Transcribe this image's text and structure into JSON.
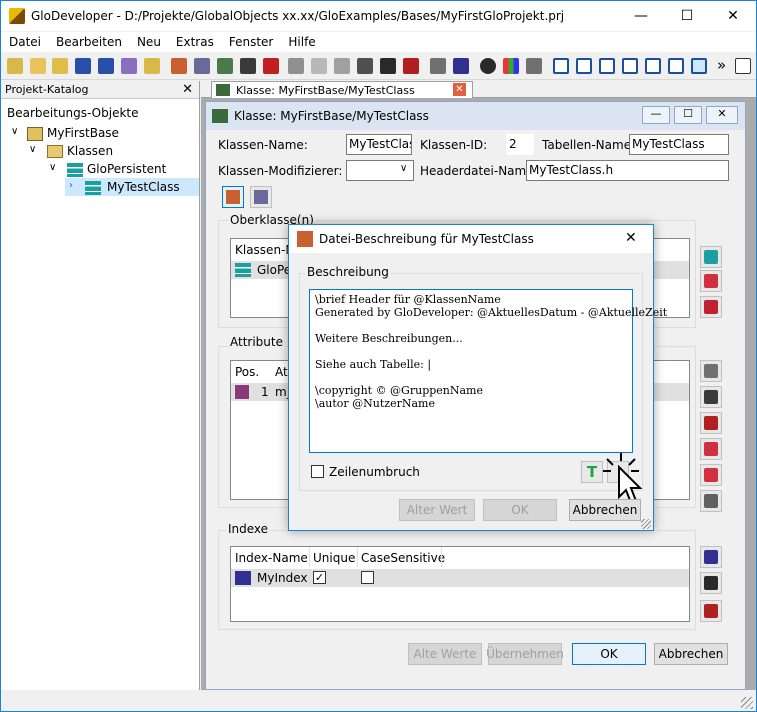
{
  "app": {
    "title": "GloDeveloper - D:/Projekte/GlobalObjects xx.xx/GloExamples/Bases/MyFirstGloProjekt.prj"
  },
  "menu": [
    "Datei",
    "Bearbeiten",
    "Neu",
    "Extras",
    "Fenster",
    "Hilfe"
  ],
  "toolbar": {
    "overflow": "»"
  },
  "catalog": {
    "title": "Projekt-Katalog",
    "root": "Bearbeitungs-Objekte",
    "items": [
      "MyFirstBase",
      "Klassen",
      "GloPersistent",
      "MyTestClass"
    ]
  },
  "tab": {
    "label": "Klasse: MyFirstBase/MyTestClass"
  },
  "classwin": {
    "title": "Klasse: MyFirstBase/MyTestClass",
    "klassen_name_label": "Klassen-Name:",
    "klassen_name": "MyTestClass",
    "klassen_id_label": "Klassen-ID:",
    "klassen_id": "2",
    "tabellen_name_label": "Tabellen-Name :",
    "tabellen_name": "MyTestClass",
    "modifizierer_label": "Klassen-Modifizierer:",
    "modifizierer": "",
    "header_label": "Headerdatei-Name :",
    "header": "MyTestClass.h",
    "oberklasse_label": "Oberklasse(n)",
    "oberklasse_col": "Klassen-N",
    "oberklasse_row": "GloPe",
    "attribute_label": "Attribute",
    "attr_col_pos": "Pos.",
    "attr_col_at": "At",
    "attr_row_pos": "1",
    "attr_row_name": "m_",
    "index_label": "Indexe",
    "index_cols": [
      "Index-Name",
      "Unique",
      "CaseSensitive"
    ],
    "index_row": "MyIndex",
    "btn_alte_werte": "Alte Werte",
    "btn_uebernehmen": "Übernehmen",
    "btn_ok": "OK",
    "btn_abbrechen": "Abbrechen"
  },
  "dialog": {
    "title": "Datei-Beschreibung für MyTestClass",
    "group": "Beschreibung",
    "lines": [
      "\\brief Header für @KlassenName",
      "Generated by GloDeveloper: @AktuellesDatum - @AktuelleZeit",
      "",
      "Weitere Beschreibungen...",
      "",
      "Siehe auch Tabelle: |",
      "",
      "\\copyright © @GruppenName",
      "\\autor @NutzerName"
    ],
    "wrap_label": "Zeilenumbruch",
    "btn_alter_wert": "Alter Wert",
    "btn_ok": "OK",
    "btn_abbrechen": "Abbrechen"
  },
  "colors": {
    "accent": "#0078d7",
    "mdi_bg": "#ababab",
    "selection": "#cce8ff"
  }
}
